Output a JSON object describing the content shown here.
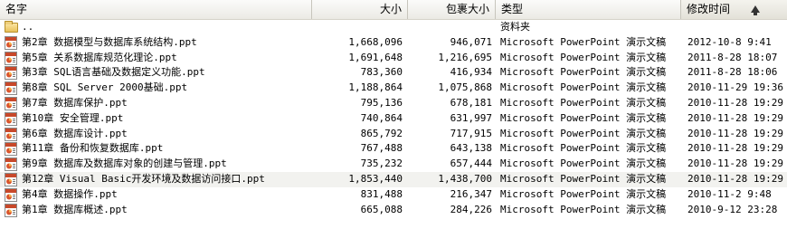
{
  "columns": {
    "name": "名字",
    "size": "大小",
    "packed": "包裹大小",
    "type": "类型",
    "modified": "修改时间"
  },
  "sort_icon": "sort-ascending-arrow-icon",
  "rows": [
    {
      "icon": "folder-icon",
      "name": "..",
      "size": "",
      "packed": "",
      "type": "资料夹",
      "modified": ""
    },
    {
      "icon": "ppt-icon",
      "name": "第2章 数据模型与数据库系统结构.ppt",
      "size": "1,668,096",
      "packed": "946,071",
      "type": "Microsoft PowerPoint 演示文稿",
      "modified": "2012-10-8 9:41"
    },
    {
      "icon": "ppt-icon",
      "name": "第5章 关系数据库规范化理论.ppt",
      "size": "1,691,648",
      "packed": "1,216,695",
      "type": "Microsoft PowerPoint 演示文稿",
      "modified": "2011-8-28 18:07"
    },
    {
      "icon": "ppt-icon",
      "name": "第3章 SQL语言基础及数据定义功能.ppt",
      "size": "783,360",
      "packed": "416,934",
      "type": "Microsoft PowerPoint 演示文稿",
      "modified": "2011-8-28 18:06"
    },
    {
      "icon": "ppt-icon",
      "name": "第8章 SQL Server 2000基础.ppt",
      "size": "1,188,864",
      "packed": "1,075,868",
      "type": "Microsoft PowerPoint 演示文稿",
      "modified": "2010-11-29 19:36"
    },
    {
      "icon": "ppt-icon",
      "name": "第7章 数据库保护.ppt",
      "size": "795,136",
      "packed": "678,181",
      "type": "Microsoft PowerPoint 演示文稿",
      "modified": "2010-11-28 19:29"
    },
    {
      "icon": "ppt-icon",
      "name": "第10章 安全管理.ppt",
      "size": "740,864",
      "packed": "631,997",
      "type": "Microsoft PowerPoint 演示文稿",
      "modified": "2010-11-28 19:29"
    },
    {
      "icon": "ppt-icon",
      "name": "第6章 数据库设计.ppt",
      "size": "865,792",
      "packed": "717,915",
      "type": "Microsoft PowerPoint 演示文稿",
      "modified": "2010-11-28 19:29"
    },
    {
      "icon": "ppt-icon",
      "name": "第11章 备份和恢复数据库.ppt",
      "size": "767,488",
      "packed": "643,138",
      "type": "Microsoft PowerPoint 演示文稿",
      "modified": "2010-11-28 19:29"
    },
    {
      "icon": "ppt-icon",
      "name": "第9章 数据库及数据库对象的创建与管理.ppt",
      "size": "735,232",
      "packed": "657,444",
      "type": "Microsoft PowerPoint 演示文稿",
      "modified": "2010-11-28 19:29"
    },
    {
      "icon": "ppt-icon",
      "name": "第12章 Visual Basic开发环境及数据访问接口.ppt",
      "size": "1,853,440",
      "packed": "1,438,700",
      "type": "Microsoft PowerPoint 演示文稿",
      "modified": "2010-11-28 19:29",
      "selected": true
    },
    {
      "icon": "ppt-icon",
      "name": "第4章 数据操作.ppt",
      "size": "831,488",
      "packed": "216,347",
      "type": "Microsoft PowerPoint 演示文稿",
      "modified": "2010-11-2 9:48"
    },
    {
      "icon": "ppt-icon",
      "name": "第1章 数据库概述.ppt",
      "size": "665,088",
      "packed": "284,226",
      "type": "Microsoft PowerPoint 演示文稿",
      "modified": "2010-9-12 23:28"
    }
  ]
}
